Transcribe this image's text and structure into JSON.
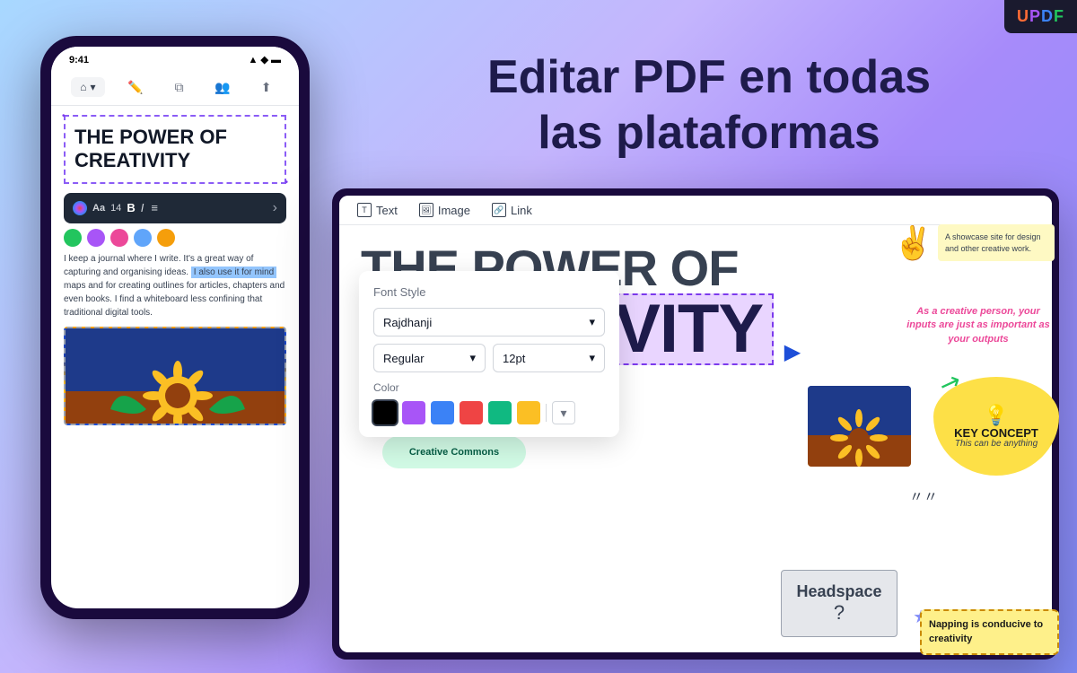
{
  "app": {
    "name": "UPDF",
    "logo_letters": [
      "U",
      "P",
      "D",
      "F"
    ]
  },
  "hero": {
    "title_line1": "Editar PDF en todas",
    "title_line2": "las plataformas"
  },
  "phone": {
    "status_time": "9:41",
    "title_text": "THE POWER OF CREATIVITY",
    "body_text_1": "I keep a journal where I write. It's a great way of capturing and organising ideas.",
    "highlight_text": "I also use it for mind",
    "body_text_2": "maps and for creating outlines for articles, chapters and even books. I find a whiteboard less confining that traditional digital tools."
  },
  "toolbar": {
    "tools": [
      "Text",
      "Image",
      "Link"
    ]
  },
  "tablet": {
    "title_line1": "THE POWER OF",
    "title_line2": "CREATIVITY",
    "body_text": "I keep a journal where I write. It's a great way of capturing and organising ideas. I also use it for mind maps and for creating outlines for articles, chapters and even books. I find a whiteboard less confining that traditional digital tools.",
    "image_label": "Creative Commons"
  },
  "font_panel": {
    "title": "Font Style",
    "font_name": "Rajdhanji",
    "style": "Regular",
    "size": "12pt",
    "color_label": "Color",
    "colors": [
      "#000000",
      "#a855f7",
      "#3b82f6",
      "#ef4444",
      "#10b981",
      "#fbbf24"
    ],
    "more_icon": "▾"
  },
  "decorations": {
    "peace_emoji": "✌️",
    "showcase_text": "A showcase site for design and other creative work.",
    "italic_quote": "As a creative person, your inputs are just as important as your outputs",
    "key_concept_title": "KEY CONCEPT",
    "key_concept_sub": "This can be anything",
    "headspace_label": "Headspace",
    "headspace_question": "?",
    "napping_text": "Napping is conducive to creativity"
  }
}
